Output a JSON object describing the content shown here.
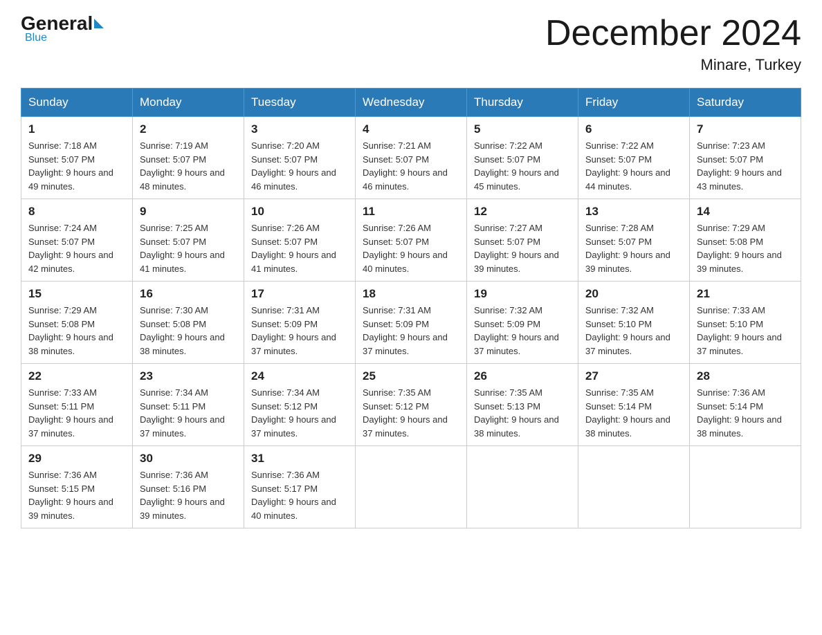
{
  "header": {
    "logo_general": "General",
    "logo_blue": "Blue",
    "month_title": "December 2024",
    "location": "Minare, Turkey"
  },
  "days_of_week": [
    "Sunday",
    "Monday",
    "Tuesday",
    "Wednesday",
    "Thursday",
    "Friday",
    "Saturday"
  ],
  "weeks": [
    [
      {
        "day": "1",
        "sunrise": "7:18 AM",
        "sunset": "5:07 PM",
        "daylight": "9 hours and 49 minutes."
      },
      {
        "day": "2",
        "sunrise": "7:19 AM",
        "sunset": "5:07 PM",
        "daylight": "9 hours and 48 minutes."
      },
      {
        "day": "3",
        "sunrise": "7:20 AM",
        "sunset": "5:07 PM",
        "daylight": "9 hours and 46 minutes."
      },
      {
        "day": "4",
        "sunrise": "7:21 AM",
        "sunset": "5:07 PM",
        "daylight": "9 hours and 46 minutes."
      },
      {
        "day": "5",
        "sunrise": "7:22 AM",
        "sunset": "5:07 PM",
        "daylight": "9 hours and 45 minutes."
      },
      {
        "day": "6",
        "sunrise": "7:22 AM",
        "sunset": "5:07 PM",
        "daylight": "9 hours and 44 minutes."
      },
      {
        "day": "7",
        "sunrise": "7:23 AM",
        "sunset": "5:07 PM",
        "daylight": "9 hours and 43 minutes."
      }
    ],
    [
      {
        "day": "8",
        "sunrise": "7:24 AM",
        "sunset": "5:07 PM",
        "daylight": "9 hours and 42 minutes."
      },
      {
        "day": "9",
        "sunrise": "7:25 AM",
        "sunset": "5:07 PM",
        "daylight": "9 hours and 41 minutes."
      },
      {
        "day": "10",
        "sunrise": "7:26 AM",
        "sunset": "5:07 PM",
        "daylight": "9 hours and 41 minutes."
      },
      {
        "day": "11",
        "sunrise": "7:26 AM",
        "sunset": "5:07 PM",
        "daylight": "9 hours and 40 minutes."
      },
      {
        "day": "12",
        "sunrise": "7:27 AM",
        "sunset": "5:07 PM",
        "daylight": "9 hours and 39 minutes."
      },
      {
        "day": "13",
        "sunrise": "7:28 AM",
        "sunset": "5:07 PM",
        "daylight": "9 hours and 39 minutes."
      },
      {
        "day": "14",
        "sunrise": "7:29 AM",
        "sunset": "5:08 PM",
        "daylight": "9 hours and 39 minutes."
      }
    ],
    [
      {
        "day": "15",
        "sunrise": "7:29 AM",
        "sunset": "5:08 PM",
        "daylight": "9 hours and 38 minutes."
      },
      {
        "day": "16",
        "sunrise": "7:30 AM",
        "sunset": "5:08 PM",
        "daylight": "9 hours and 38 minutes."
      },
      {
        "day": "17",
        "sunrise": "7:31 AM",
        "sunset": "5:09 PM",
        "daylight": "9 hours and 37 minutes."
      },
      {
        "day": "18",
        "sunrise": "7:31 AM",
        "sunset": "5:09 PM",
        "daylight": "9 hours and 37 minutes."
      },
      {
        "day": "19",
        "sunrise": "7:32 AM",
        "sunset": "5:09 PM",
        "daylight": "9 hours and 37 minutes."
      },
      {
        "day": "20",
        "sunrise": "7:32 AM",
        "sunset": "5:10 PM",
        "daylight": "9 hours and 37 minutes."
      },
      {
        "day": "21",
        "sunrise": "7:33 AM",
        "sunset": "5:10 PM",
        "daylight": "9 hours and 37 minutes."
      }
    ],
    [
      {
        "day": "22",
        "sunrise": "7:33 AM",
        "sunset": "5:11 PM",
        "daylight": "9 hours and 37 minutes."
      },
      {
        "day": "23",
        "sunrise": "7:34 AM",
        "sunset": "5:11 PM",
        "daylight": "9 hours and 37 minutes."
      },
      {
        "day": "24",
        "sunrise": "7:34 AM",
        "sunset": "5:12 PM",
        "daylight": "9 hours and 37 minutes."
      },
      {
        "day": "25",
        "sunrise": "7:35 AM",
        "sunset": "5:12 PM",
        "daylight": "9 hours and 37 minutes."
      },
      {
        "day": "26",
        "sunrise": "7:35 AM",
        "sunset": "5:13 PM",
        "daylight": "9 hours and 38 minutes."
      },
      {
        "day": "27",
        "sunrise": "7:35 AM",
        "sunset": "5:14 PM",
        "daylight": "9 hours and 38 minutes."
      },
      {
        "day": "28",
        "sunrise": "7:36 AM",
        "sunset": "5:14 PM",
        "daylight": "9 hours and 38 minutes."
      }
    ],
    [
      {
        "day": "29",
        "sunrise": "7:36 AM",
        "sunset": "5:15 PM",
        "daylight": "9 hours and 39 minutes."
      },
      {
        "day": "30",
        "sunrise": "7:36 AM",
        "sunset": "5:16 PM",
        "daylight": "9 hours and 39 minutes."
      },
      {
        "day": "31",
        "sunrise": "7:36 AM",
        "sunset": "5:17 PM",
        "daylight": "9 hours and 40 minutes."
      },
      null,
      null,
      null,
      null
    ]
  ]
}
